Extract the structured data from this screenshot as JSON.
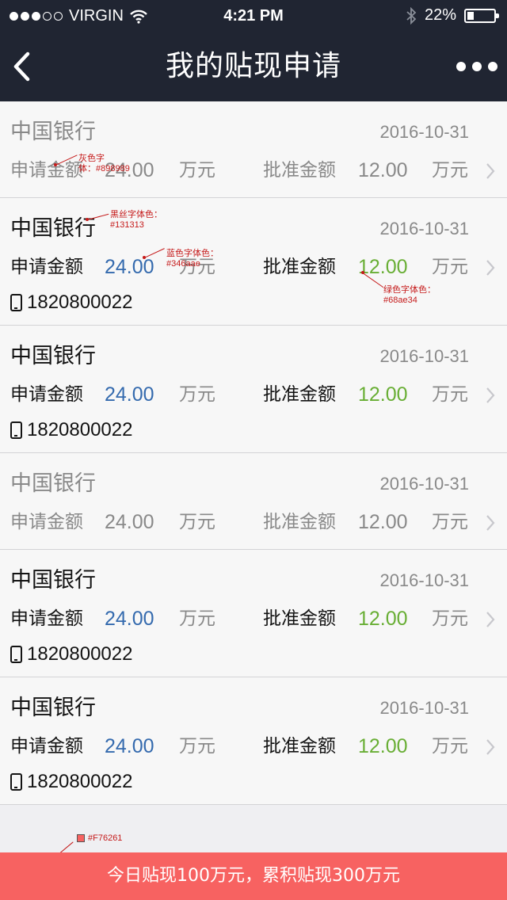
{
  "status_bar": {
    "carrier": "VIRGIN",
    "time": "4:21 PM",
    "battery": "22%",
    "signal_icon": "signal-dots-icon",
    "wifi_icon": "wifi-icon",
    "bluetooth_icon": "bluetooth-icon"
  },
  "nav": {
    "title": "我的贴现申请",
    "back_icon": "chevron-left-icon",
    "more_icon": "more-horizontal-icon"
  },
  "labels": {
    "apply_amount": "申请金额",
    "approved_amount": "批准金额",
    "unit": "万元"
  },
  "items": [
    {
      "bank": "中国银行",
      "date": "2016-10-31",
      "apply": "24.00",
      "approved": "12.00",
      "phone": ""
    },
    {
      "bank": "中国银行",
      "date": "2016-10-31",
      "apply": "24.00",
      "approved": "12.00",
      "phone": "1820800022"
    },
    {
      "bank": "中国银行",
      "date": "2016-10-31",
      "apply": "24.00",
      "approved": "12.00",
      "phone": "1820800022"
    },
    {
      "bank": "中国银行",
      "date": "2016-10-31",
      "apply": "24.00",
      "approved": "12.00",
      "phone": ""
    },
    {
      "bank": "中国银行",
      "date": "2016-10-31",
      "apply": "24.00",
      "approved": "12.00",
      "phone": "1820800022"
    },
    {
      "bank": "中国银行",
      "date": "2016-10-31",
      "apply": "24.00",
      "approved": "12.00",
      "phone": "1820800022"
    }
  ],
  "annotations": {
    "gray_line1": "灰色字",
    "gray_line2": "体：#898989",
    "black_line1": "黑丝字体色：",
    "black_line2": "#131313",
    "blue_line1": "蓝色字体色：",
    "blue_line2": "#346aae",
    "green_line1": "绿色字体色：",
    "green_line2": "#68ae34",
    "footer_color": "#F76261"
  },
  "colors": {
    "gray_text": "#898989",
    "black_text": "#131313",
    "blue_text": "#346aae",
    "green_text": "#68ae34",
    "footer_bg": "#F76261",
    "nav_bg": "#202532"
  },
  "footer": {
    "summary": "今日贴现100万元，累积贴现300万元"
  }
}
